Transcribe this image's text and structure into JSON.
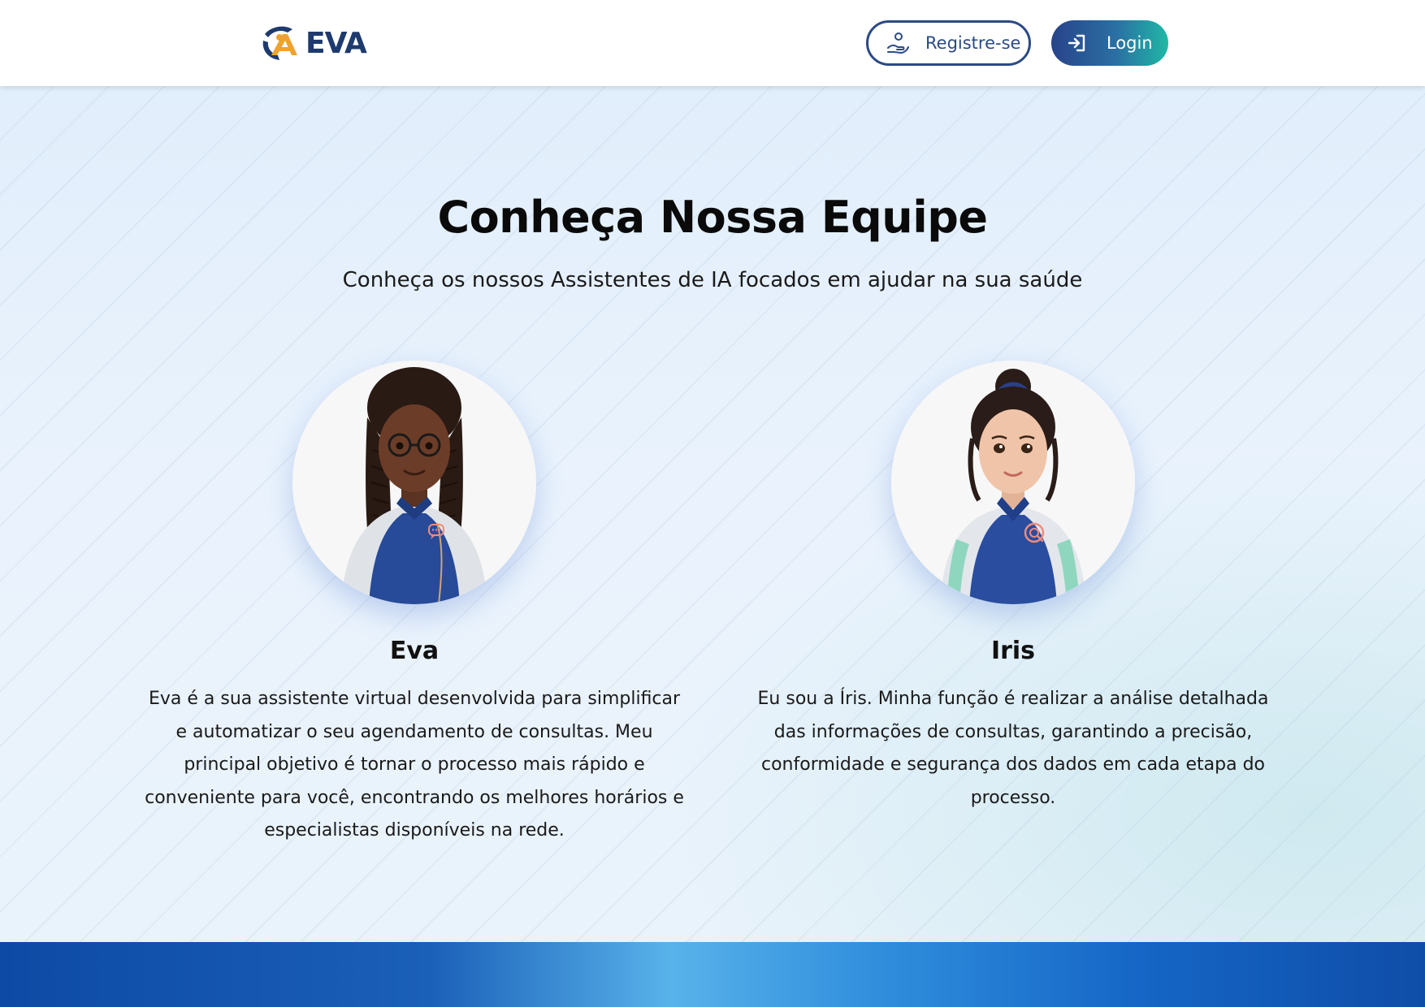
{
  "header": {
    "logo_text": "EVA",
    "register_label": "Registre-se",
    "login_label": "Login"
  },
  "hero": {
    "title": "Conheça Nossa Equipe",
    "subtitle": "Conheça os nossos Assistentes de IA focados em ajudar na sua saúde"
  },
  "team": [
    {
      "name": "Eva",
      "description": "Eva é a sua assistente virtual desenvolvida para simplificar e automatizar o seu agendamento de consultas. Meu principal objetivo é tornar o processo mais rápido e conveniente para você, encontrando os melhores horários e especialistas disponíveis na rede.",
      "badge_icon": "chat-bubble-icon"
    },
    {
      "name": "Iris",
      "description": "Eu sou a Íris. Minha função é realizar a análise detalhada das informações de consultas, garantindo a precisão, conformidade e segurança dos dados em cada etapa do processo.",
      "badge_icon": "magnifier-icon"
    }
  ],
  "colors": {
    "brand_navy": "#1e3a6e",
    "brand_orange": "#f0a22e",
    "login_gradient_start": "#27438a",
    "login_gradient_end": "#1fb8a4",
    "footer_blue": "#0d4aa5"
  }
}
